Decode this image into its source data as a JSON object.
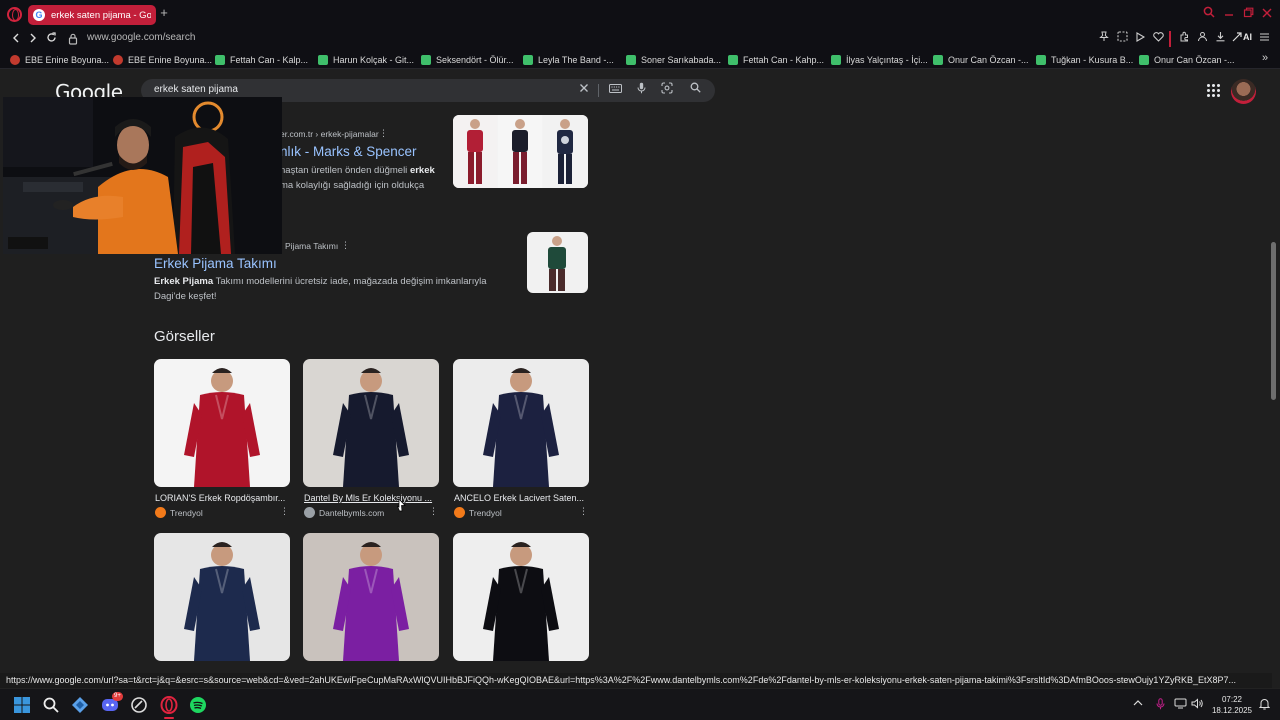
{
  "browser": {
    "tab": {
      "title": "erkek saten pijama - Google",
      "favicon": "google-g"
    },
    "new_tab_label": "+",
    "url": "www.google.com/search",
    "toolbar_ai_label": "AI"
  },
  "bookmarks": [
    {
      "label": "EBE Enine Boyuna...",
      "icon": "red"
    },
    {
      "label": "EBE Enine Boyuna...",
      "icon": "red"
    },
    {
      "label": "Fettah Can - Kalp...",
      "icon": "green"
    },
    {
      "label": "Harun Kolçak - Git...",
      "icon": "green"
    },
    {
      "label": "Seksendört - Ölür...",
      "icon": "green"
    },
    {
      "label": "Leyla The Band -...",
      "icon": "green"
    },
    {
      "label": "Soner Sarıkabada...",
      "icon": "green"
    },
    {
      "label": "Fettah Can - Kahp...",
      "icon": "green"
    },
    {
      "label": "İlyas Yalçıntaş - İçi...",
      "icon": "green"
    },
    {
      "label": "Onur Can Özcan -...",
      "icon": "green"
    },
    {
      "label": "Tuğkan - Kusura B...",
      "icon": "green"
    },
    {
      "label": "Onur Can Özcan -...",
      "icon": "green"
    }
  ],
  "google": {
    "logo": "Google",
    "query": "erkek saten pijama"
  },
  "results": [
    {
      "breadcrumb": "er.com.tr › erkek-pijamalar",
      "title": "nlık - Marks & Spencer",
      "snippet_line1_pre": "naştan üretilen önden düğmeli ",
      "snippet_line1_bold": "erkek",
      "snippet_line2": "ma kolaylığı sağladığı için oldukça"
    },
    {
      "breadcrumb": "Pijama Takımı",
      "title": "Erkek Pijama Takımı",
      "snippet_bold": "Erkek Pijama",
      "snippet_rest": " Takımı modellerini ücretsiz iade, mağazada değişim imkanlarıyla",
      "snippet_line2": "Dagi'de keşfet!"
    }
  ],
  "images_section": {
    "title": "Görseller",
    "items": [
      {
        "caption": "LORIAN'S Erkek Ropdöşambır...",
        "source": "Trendyol",
        "source_color": "#f27a1a",
        "robe": "#b0142a",
        "bg": "#f4f4f4"
      },
      {
        "caption": "Dantel By Mls Er Koleksiyonu ...",
        "source": "Dantelbymls.com",
        "source_color": "#9aa0a6",
        "robe": "#161a2e",
        "bg": "#d9d6d2"
      },
      {
        "caption": "ANCELO Erkek Lacivert Saten...",
        "source": "Trendyol",
        "source_color": "#f27a1a",
        "robe": "#1c2140",
        "bg": "#ececec"
      },
      {
        "caption": "",
        "source": "",
        "source_color": "#f27a1a",
        "robe": "#1d2a4d",
        "bg": "#e6e6e6"
      },
      {
        "caption": "",
        "source": "",
        "source_color": "#f27a1a",
        "robe": "#7b1fa2",
        "bg": "#c9c2bd"
      },
      {
        "caption": "",
        "source": "",
        "source_color": "#f27a1a",
        "robe": "#0d0d12",
        "bg": "#eeeeee"
      }
    ]
  },
  "status_url": "https://www.google.com/url?sa=t&rct=j&q=&esrc=s&source=web&cd=&ved=2ahUKEwiFpeCupMaRAxWlQVUIHbBJFiQQh-wKegQIOBAE&url=https%3A%2F%2Fwww.dantelbymls.com%2Fde%2Fdantel-by-mls-er-koleksiyonu-erkek-saten-pijama-takimi%3FsrsltId%3DAfmBOoos-stewOujy1YZyRKB_EtX8P7...",
  "taskbar": {
    "time": "07:22",
    "date": "18.12.2025",
    "discord_badge": "9+"
  },
  "colors": {
    "accent": "#c21f3a",
    "link": "#99c3ff",
    "page_bg": "#1f1f1f"
  }
}
